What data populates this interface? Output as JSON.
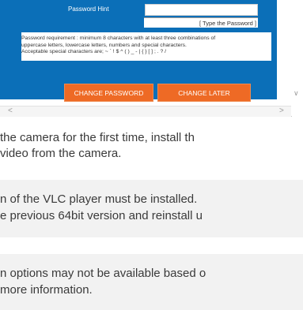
{
  "dialog": {
    "password_hint_label": "Password Hint",
    "password_hint_value": "",
    "type_password_text": "[ Type the Password ]",
    "requirement_lines": [
      "Password requirement : minimum 8 characters with at least three combinations of",
      "uppercase letters, lowercase letters, numbers and special characters.",
      "Acceptable special characters are; ~ ` ! $ ^ ( ) _ - | { } [ ] ; . ? /"
    ],
    "change_password_label": "CHANGE PASSWORD",
    "change_later_label": "CHANGE LATER",
    "scroll_left_glyph": "<",
    "scroll_right_glyph": ">",
    "scroll_down_glyph": "∨"
  },
  "colors": {
    "panel_blue": "#0b6fb8",
    "button_orange": "#ee6a25",
    "note_background": "#f2f2f2"
  },
  "body_text": {
    "paragraph_lines": [
      "the camera for the first time, install th",
      "video from the camera."
    ],
    "note1_lines": [
      "n of the VLC player must be installed.",
      "e previous 64bit version and reinstall u"
    ],
    "note2_lines": [
      "n options may not be available based o",
      "more information."
    ]
  }
}
